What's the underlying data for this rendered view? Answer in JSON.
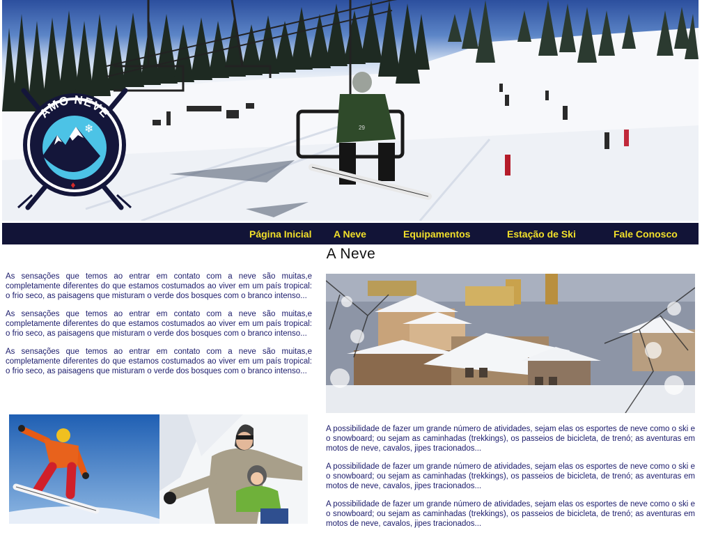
{
  "nav": {
    "items": [
      {
        "label": "Página Inicial"
      },
      {
        "label": "A Neve"
      },
      {
        "label": "Equipamentos"
      },
      {
        "label": "Estação de Ski"
      },
      {
        "label": "Fale Conosco"
      }
    ]
  },
  "logo": {
    "text": "AMO NEVE"
  },
  "hero": {
    "chair_number": "29"
  },
  "page": {
    "title": "A Neve"
  },
  "left": {
    "paragraphs": [
      "As sensações que temos ao entrar em contato com a neve são muitas,e completamente diferentes do que estamos costumados ao viver em um país tropical: o frio seco, as paisagens que misturam o verde dos bosques com o branco intenso...",
      "As sensações que temos ao entrar em contato com a neve são muitas,e completamente diferentes do que estamos costumados ao viver em um país tropical: o frio seco, as paisagens que misturam o verde dos bosques com o branco intenso...",
      "As sensações que temos ao entrar em contato com a neve são muitas,e completamente diferentes do que estamos costumados ao viver em um país tropical: o frio seco, as paisagens que misturam o verde dos bosques com o branco intenso..."
    ]
  },
  "right": {
    "paragraphs": [
      "A possibilidade de fazer um grande número de atividades, sejam elas os esportes de neve como o ski e o snowboard; ou sejam as caminhadas (trekkings), os passeios de bicicleta, de trenó; as aventuras em motos de neve, cavalos, jipes tracionados...",
      "A possibilidade de fazer um grande número de atividades, sejam elas os esportes de neve como o ski e o snowboard; ou sejam as caminhadas (trekkings), os passeios de bicicleta, de trenó; as aventuras em motos de neve, cavalos, jipes tracionados...",
      "A possibilidade de fazer um grande número de atividades, sejam elas os esportes de neve como o ski e o snowboard; ou sejam as caminhadas (trekkings), os passeios de bicicleta, de trenó; as aventuras em motos de neve, cavalos, jipes tracionados..."
    ]
  },
  "colors": {
    "nav_bg": "#121437",
    "nav_text": "#f2e02a",
    "body_text": "#1b1b6b",
    "logo_ring": "#14163a",
    "logo_sky": "#4cc3e6"
  }
}
